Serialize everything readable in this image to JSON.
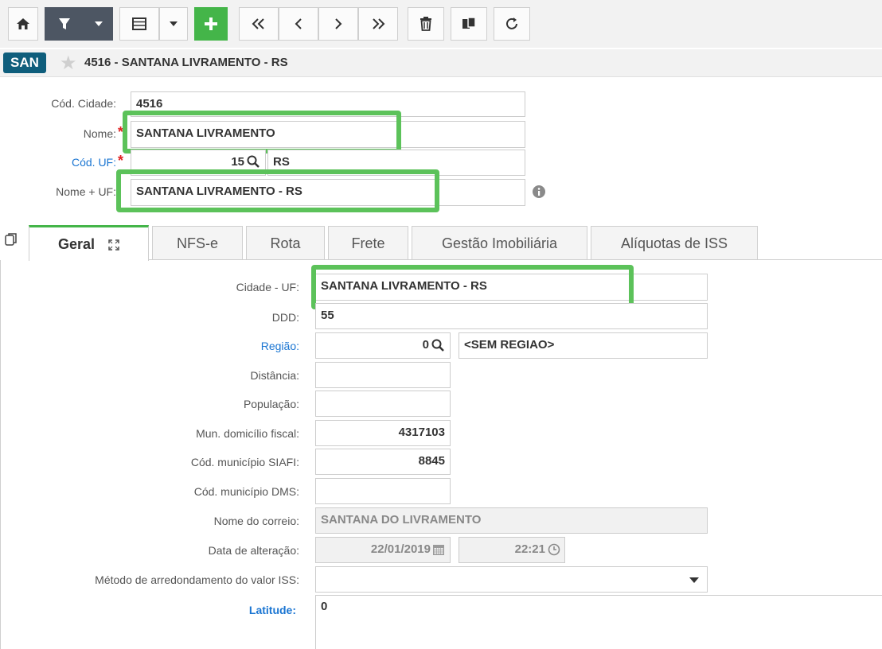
{
  "toolbar": {
    "buttons": [
      {
        "name": "home-icon",
        "glyph": "🏠"
      },
      {
        "name": "filter-icon",
        "glyph": "⏷"
      },
      {
        "name": "grid-icon",
        "glyph": "▤"
      },
      {
        "name": "add-icon",
        "glyph": "+"
      },
      {
        "name": "first-icon",
        "glyph": "«"
      },
      {
        "name": "prev-icon",
        "glyph": "‹"
      },
      {
        "name": "next-icon",
        "glyph": "›"
      },
      {
        "name": "last-icon",
        "glyph": "»"
      },
      {
        "name": "delete-icon",
        "glyph": "🗑"
      },
      {
        "name": "copy-icon",
        "glyph": "⧉"
      },
      {
        "name": "refresh-icon",
        "glyph": "⟳"
      }
    ]
  },
  "header": {
    "badge": "SAN",
    "title": "4516 - SANTANA LIVRAMENTO - RS"
  },
  "form": {
    "cod_cidade": {
      "label": "Cód. Cidade:",
      "value": "4516"
    },
    "nome": {
      "label": "Nome:",
      "required": "*",
      "value": "SANTANA LIVRAMENTO"
    },
    "cod_uf": {
      "label": "Cód. UF:",
      "required": "*",
      "value": "15",
      "desc": "RS"
    },
    "nome_uf": {
      "label": "Nome + UF:",
      "value": "SANTANA LIVRAMENTO - RS"
    }
  },
  "tabs": [
    {
      "label": "Geral"
    },
    {
      "label": "NFS-e"
    },
    {
      "label": "Rota"
    },
    {
      "label": "Frete"
    },
    {
      "label": "Gestão Imobiliária"
    },
    {
      "label": "Alíquotas de ISS"
    }
  ],
  "geral": {
    "cidade_uf": {
      "label": "Cidade - UF:",
      "value": "SANTANA LIVRAMENTO - RS"
    },
    "ddd": {
      "label": "DDD:",
      "value": "55"
    },
    "regiao": {
      "label": "Região:",
      "value": "0",
      "desc": "<SEM REGIAO>"
    },
    "distancia": {
      "label": "Distância:",
      "value": ""
    },
    "populacao": {
      "label": "População:",
      "value": ""
    },
    "mun_domicilio": {
      "label": "Mun. domicílio fiscal:",
      "value": "4317103"
    },
    "cod_siafi": {
      "label": "Cód. município SIAFI:",
      "value": "8845"
    },
    "cod_dms": {
      "label": "Cód. município DMS:",
      "value": ""
    },
    "nome_correio": {
      "label": "Nome do correio:",
      "value": "SANTANA DO LIVRAMENTO"
    },
    "data_alteracao": {
      "label": "Data de alteração:",
      "date": "22/01/2019",
      "time": "22:21"
    },
    "metodo": {
      "label": "Método de arredondamento do valor ISS:",
      "value": ""
    },
    "latitude": {
      "label": "Latitude:",
      "value": "0"
    }
  },
  "colors": {
    "accent_green": "#44b549",
    "highlight": "#5cc25a",
    "badge": "#0f5e7c",
    "link_blue": "#1a75d2"
  }
}
